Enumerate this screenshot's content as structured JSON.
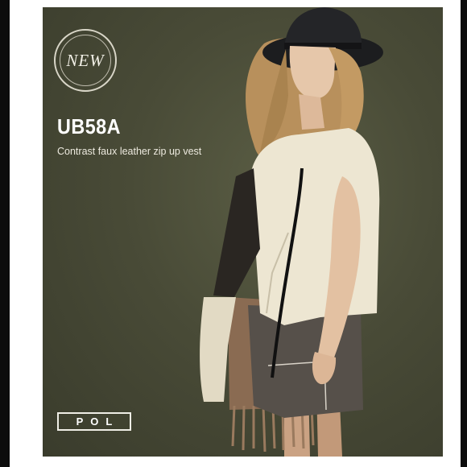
{
  "badge": {
    "text": "NEW"
  },
  "product": {
    "code": "UB58A",
    "description": "Contrast faux leather zip up vest"
  },
  "brand": {
    "name": "POL"
  },
  "colors": {
    "background_panel": "#494b37",
    "text": "#ffffff",
    "frame": "#0c0c0c"
  },
  "photo": {
    "subject": "model-wearing-vest-and-hat"
  }
}
